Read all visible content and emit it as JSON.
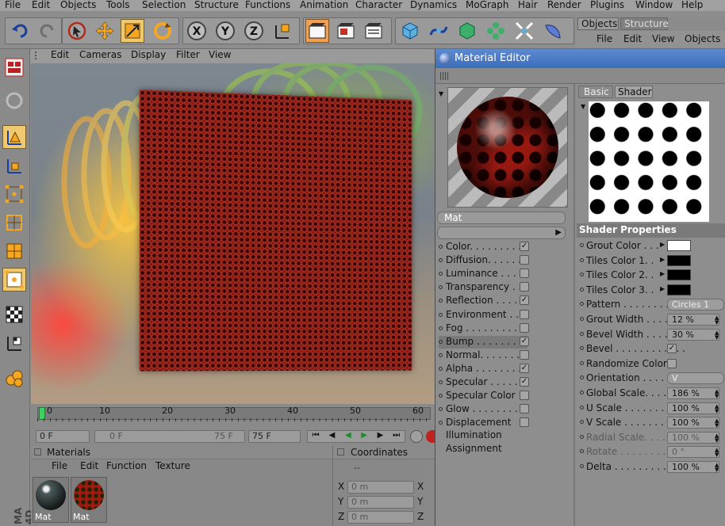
{
  "menubar": {
    "items": [
      "File",
      "Edit",
      "Objects",
      "Tools",
      "Selection",
      "Structure",
      "Functions",
      "Animation",
      "Character",
      "Dynamics",
      "MoGraph",
      "Hair",
      "Render",
      "Plugins",
      "Window",
      "Help"
    ]
  },
  "objects_panel": {
    "tabs": [
      "Objects",
      "Structure"
    ],
    "menu": [
      "File",
      "Edit",
      "View",
      "Objects"
    ]
  },
  "viewport": {
    "menu": [
      "Edit",
      "Cameras",
      "Display",
      "Filter",
      "View"
    ]
  },
  "timeline": {
    "ticks": [
      "0",
      "10",
      "20",
      "30",
      "40",
      "50",
      "60"
    ]
  },
  "time_controls": {
    "current_frame": "0 F",
    "range_start": "0 F",
    "range_end": "75 F",
    "max_frame": "75 F"
  },
  "materials_panel": {
    "title": "Materials",
    "menu": [
      "File",
      "Edit",
      "Function",
      "Texture"
    ],
    "materials": [
      "Mat",
      "Mat"
    ]
  },
  "coordinates_panel": {
    "title": "Coordinates",
    "header_value": "--",
    "rows": [
      {
        "axis": "X",
        "value": "0 m",
        "axis2": "X"
      },
      {
        "axis": "Y",
        "value": "0 m",
        "axis2": "Y"
      },
      {
        "axis": "Z",
        "value": "0 m",
        "axis2": "Z"
      }
    ]
  },
  "brand_text": "MA 4D",
  "material_editor": {
    "title": "Material Editor",
    "material_name": "Mat",
    "tabs": [
      "Basic",
      "Shader"
    ],
    "active_tab": "Shader",
    "channels": [
      {
        "label": "Color. . . . . . . . .",
        "checked": true
      },
      {
        "label": "Diffusion. . . . . .",
        "checked": false
      },
      {
        "label": "Luminance . . . .",
        "checked": false
      },
      {
        "label": "Transparency . .",
        "checked": false
      },
      {
        "label": "Reflection . . . . .",
        "checked": true
      },
      {
        "label": "Environment . . .",
        "checked": false
      },
      {
        "label": "Fog . . . . . . . . . .",
        "checked": false
      },
      {
        "label": "Bump . . . . . . . .",
        "checked": true
      },
      {
        "label": "Normal. . . . . . . .",
        "checked": false
      },
      {
        "label": "Alpha . . . . . . . .",
        "checked": true
      },
      {
        "label": "Specular . . . . . .",
        "checked": true
      },
      {
        "label": "Specular Color",
        "checked": false
      },
      {
        "label": "Glow . . . . . . . . .",
        "checked": false
      },
      {
        "label": "Displacement",
        "checked": false
      }
    ],
    "extra_items": [
      "Illumination",
      "Assignment"
    ],
    "selected_channel": "Bump",
    "shader_properties_title": "Shader Properties",
    "properties": [
      {
        "label": "Grout Color . . .",
        "type": "color",
        "value": "#ffffff",
        "arrow": true
      },
      {
        "label": "Tiles Color 1. .",
        "type": "color",
        "value": "#000000",
        "arrow": true
      },
      {
        "label": "Tiles Color 2. .",
        "type": "color",
        "value": "#000000",
        "arrow": true
      },
      {
        "label": "Tiles Color 3. .",
        "type": "color",
        "value": "#000000",
        "arrow": true
      },
      {
        "label": "Pattern . . . . . . . . . . .",
        "type": "select",
        "value": "Circles 1"
      },
      {
        "label": "Grout Width . . . . . .",
        "type": "number",
        "value": "12 %"
      },
      {
        "label": "Bevel Width . . . . . .",
        "type": "number",
        "value": "30 %"
      },
      {
        "label": "Bevel . . . . . . . . . . . .",
        "type": "check",
        "value": true
      },
      {
        "label": "Randomize Color",
        "type": "check",
        "value": false
      },
      {
        "label": "Orientation . . . . . . .",
        "type": "select",
        "value": "V"
      },
      {
        "label": "Global Scale. . . . . .",
        "type": "number",
        "value": "186 %"
      },
      {
        "label": "U Scale . . . . . . . . . .",
        "type": "number",
        "value": "100 %"
      },
      {
        "label": "V Scale . . . . . . . . . .",
        "type": "number",
        "value": "100 %"
      },
      {
        "label": "Radial Scale. . . . . .",
        "type": "number",
        "value": "100 %",
        "disabled": true
      },
      {
        "label": "Rotate . . . . . . . . . . .",
        "type": "number",
        "value": "0 °",
        "disabled": true
      },
      {
        "label": "Delta . . . . . . . . . . . .",
        "type": "number",
        "value": "100 %"
      }
    ]
  },
  "colors": {
    "titlebar": "#3b6db9",
    "material_red": "#8e1810",
    "selected_row": "#7a7a7a"
  }
}
